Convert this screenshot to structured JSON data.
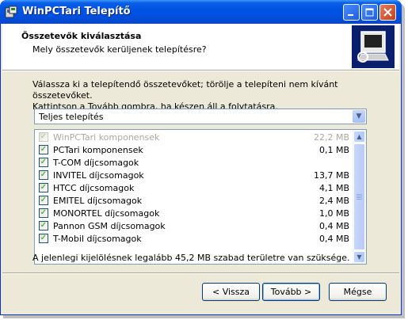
{
  "window": {
    "title": "WinPCTari Telepítő"
  },
  "header": {
    "title": "Összetevők kiválasztása",
    "subtitle": "Mely összetevők kerüljenek telepítésre?"
  },
  "instructions": {
    "line1": "Válassza ki a telepítendő összetevőket; törölje a telepíteni nem kívánt összetevőket.",
    "line2": "Kattintson a Tovább gombra, ha készen áll a folytatásra."
  },
  "setup_type": {
    "selected": "Teljes telepítés"
  },
  "components": [
    {
      "name": "WinPCTari komponensek",
      "size": "22,2 MB",
      "checked": true,
      "disabled": true
    },
    {
      "name": "PCTari komponensek",
      "size": "0,1 MB",
      "checked": true,
      "disabled": false
    },
    {
      "name": "T-COM díjcsomagok",
      "size": "",
      "checked": true,
      "disabled": false
    },
    {
      "name": "INVITEL díjcsomagok",
      "size": "13,7 MB",
      "checked": true,
      "disabled": false
    },
    {
      "name": "HTCC díjcsomagok",
      "size": "4,1 MB",
      "checked": true,
      "disabled": false
    },
    {
      "name": "EMITEL díjcsomagok",
      "size": "2,4 MB",
      "checked": true,
      "disabled": false
    },
    {
      "name": "MONORTEL díjcsomagok",
      "size": "1,0 MB",
      "checked": true,
      "disabled": false
    },
    {
      "name": "Pannon GSM díjcsomagok",
      "size": "0,4 MB",
      "checked": true,
      "disabled": false
    },
    {
      "name": "T-Mobil díjcsomagok",
      "size": "0,4 MB",
      "checked": true,
      "disabled": false
    }
  ],
  "disk_space": "A jelenlegi kijelölésnek legalább 45,2 MB szabad területre van szüksége.",
  "buttons": {
    "back": "< Vissza",
    "next": "Tovább >",
    "cancel": "Mégse"
  },
  "checkmark": "✓"
}
